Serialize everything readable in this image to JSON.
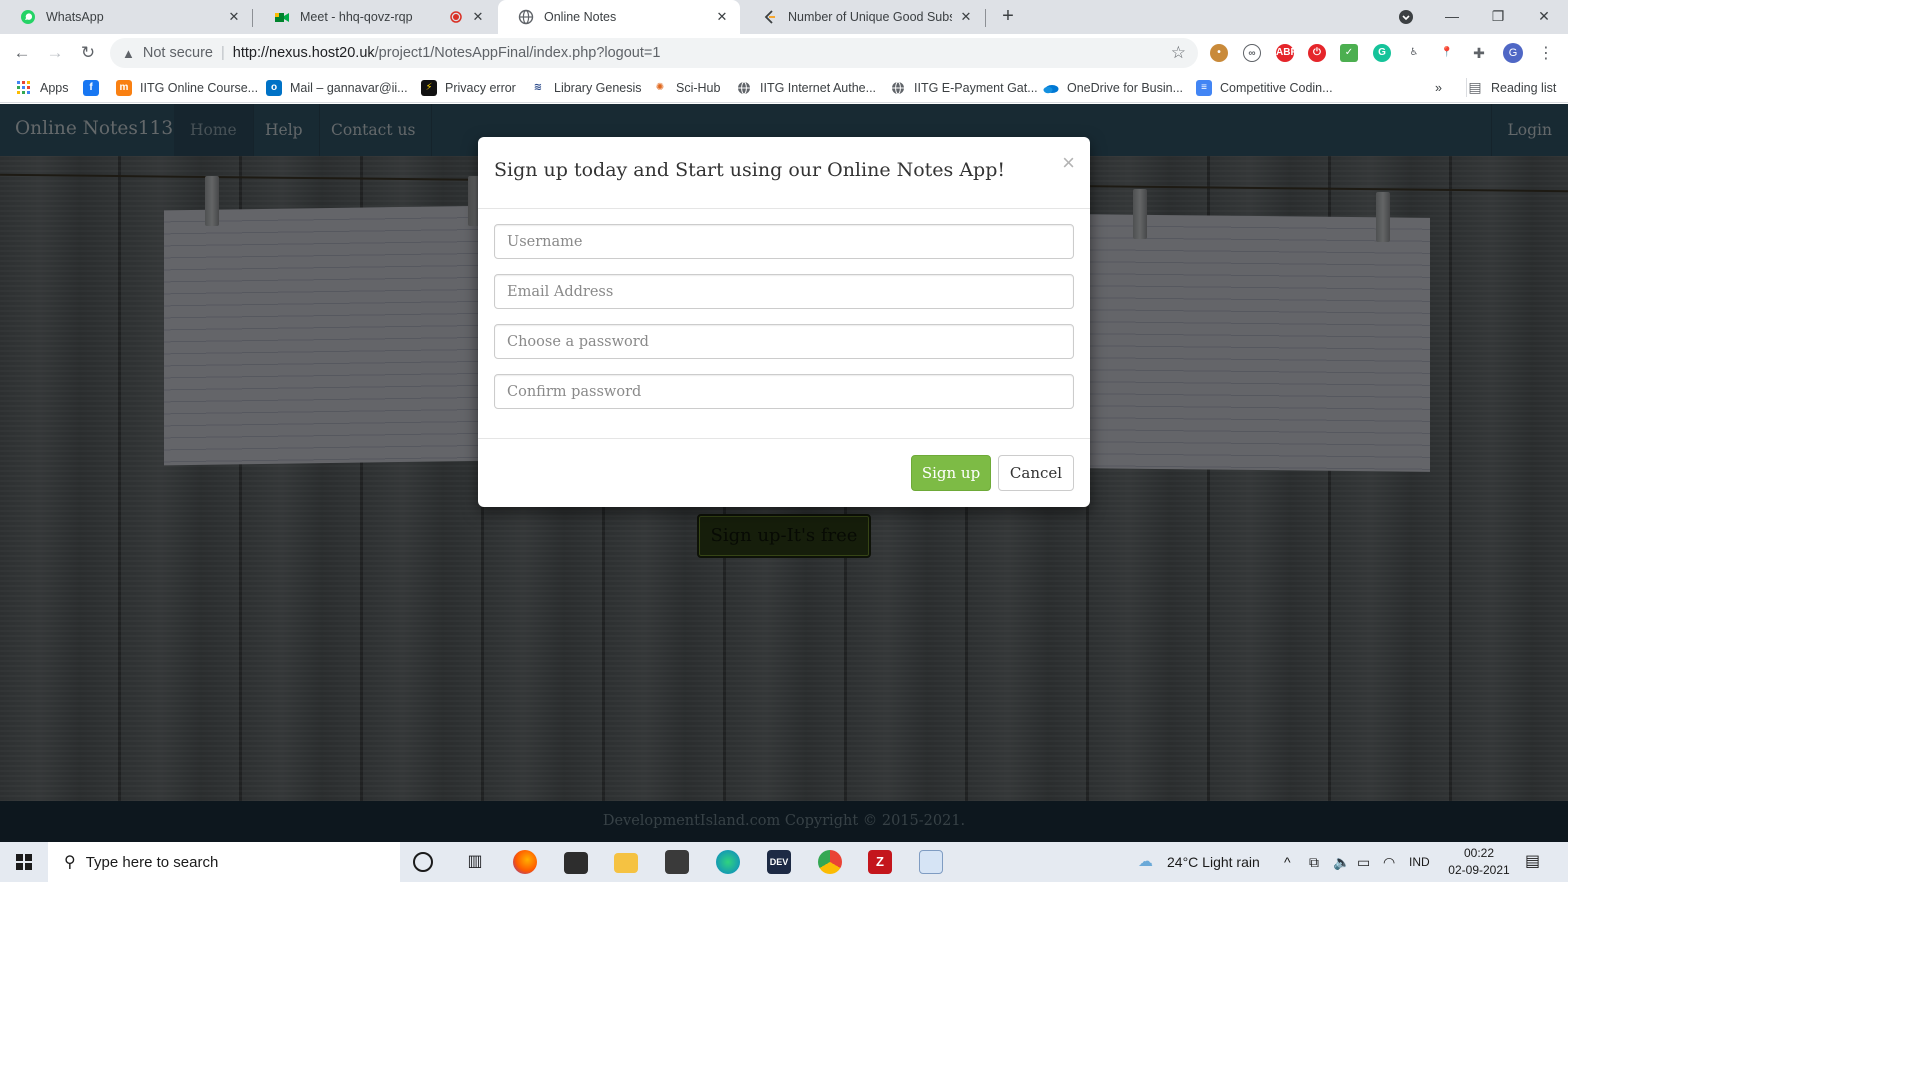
{
  "browser": {
    "tabs": [
      {
        "title": "WhatsApp",
        "icon": "whatsapp-icon"
      },
      {
        "title": "Meet - hhq-qovz-rqp",
        "icon": "google-meet-icon",
        "recording": true
      },
      {
        "title": "Online Notes",
        "icon": "globe-icon",
        "active": true
      },
      {
        "title": "Number of Unique Good Subseq",
        "icon": "leetcode-icon"
      }
    ],
    "address": {
      "security": "Not secure",
      "url_host": "http://nexus.host20.uk",
      "url_rest": "/project1/NotesAppFinal/index.php?logout=1"
    },
    "bookmarks": [
      {
        "label": "Apps",
        "icon": "apps-grid-icon"
      },
      {
        "label": "",
        "icon": "facebook-icon"
      },
      {
        "label": "IITG Online Course...",
        "icon": "moodle-icon"
      },
      {
        "label": "Mail – gannavar@ii...",
        "icon": "outlook-icon"
      },
      {
        "label": "Privacy error",
        "icon": "privacy-error-icon"
      },
      {
        "label": "Library Genesis",
        "icon": "libgen-icon"
      },
      {
        "label": "Sci-Hub",
        "icon": "scihub-icon"
      },
      {
        "label": "IITG Internet Authe...",
        "icon": "globe-icon"
      },
      {
        "label": "IITG E-Payment Gat...",
        "icon": "globe-icon"
      },
      {
        "label": "OneDrive for Busin...",
        "icon": "onedrive-icon"
      },
      {
        "label": "Competitive Codin...",
        "icon": "docs-icon"
      }
    ],
    "bookmarks_overflow": "»",
    "reading_list": "Reading list",
    "profile_initial": "G"
  },
  "site": {
    "brand": "Online Notes113",
    "nav": [
      "Home",
      "Help",
      "Contact us"
    ],
    "login": "Login",
    "hero_button": "Sign up-It's free",
    "footer": "DevelopmentIsland.com Copyright © 2015-2021."
  },
  "modal": {
    "title": "Sign up today and Start using our Online Notes App!",
    "close": "×",
    "fields": {
      "username": "Username",
      "email": "Email Address",
      "password": "Choose a password",
      "confirm": "Confirm password"
    },
    "signup_label": "Sign up",
    "cancel_label": "Cancel"
  },
  "taskbar": {
    "search_placeholder": "Type here to search",
    "weather": "24°C  Light rain",
    "lang": "IND",
    "time": "00:22",
    "date": "02-09-2021"
  },
  "colors": {
    "site_nav": "#315467",
    "signup_green": "#7dbb45",
    "footer": "#1a2f3c"
  }
}
